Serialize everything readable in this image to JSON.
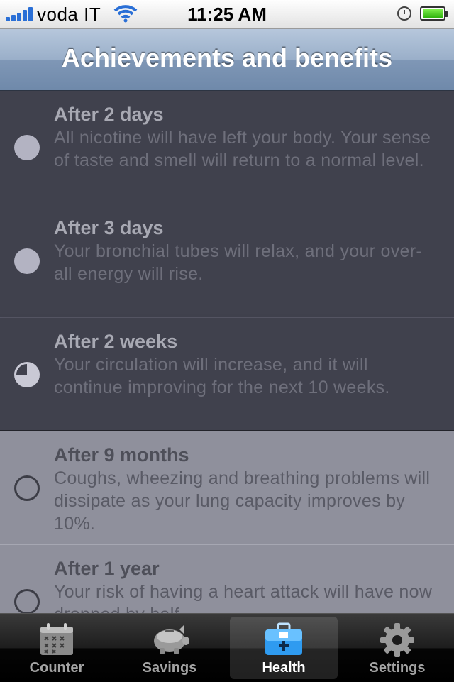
{
  "status_bar": {
    "carrier": "voda IT",
    "time": "11:25 AM"
  },
  "nav": {
    "title": "Achievements and benefits"
  },
  "achievements": [
    {
      "heading": "After 2 days",
      "description": "All nicotine will have left your body. Your sense of taste and smell will return to a normal level.",
      "state": "achieved"
    },
    {
      "heading": "After 3 days",
      "description": "Your bronchial tubes will relax, and your over-all energy will rise.",
      "state": "achieved"
    },
    {
      "heading": "After 2 weeks",
      "description": "Your circulation will increase, and it will continue improving for the next 10 weeks.",
      "state": "achieved",
      "progress": 0.75
    },
    {
      "heading": "After 9 months",
      "description": "Coughs, wheezing and breathing problems will dissipate as your lung capacity improves by 10%.",
      "state": "pending"
    },
    {
      "heading": "After 1 year",
      "description": "Your risk of having a heart attack will have now dropped by half.",
      "state": "pending"
    }
  ],
  "tabs": [
    {
      "label": "Counter",
      "icon": "calendar-icon"
    },
    {
      "label": "Savings",
      "icon": "piggy-bank-icon"
    },
    {
      "label": "Health",
      "icon": "first-aid-kit-icon",
      "selected": true
    },
    {
      "label": "Settings",
      "icon": "gear-icon"
    }
  ]
}
